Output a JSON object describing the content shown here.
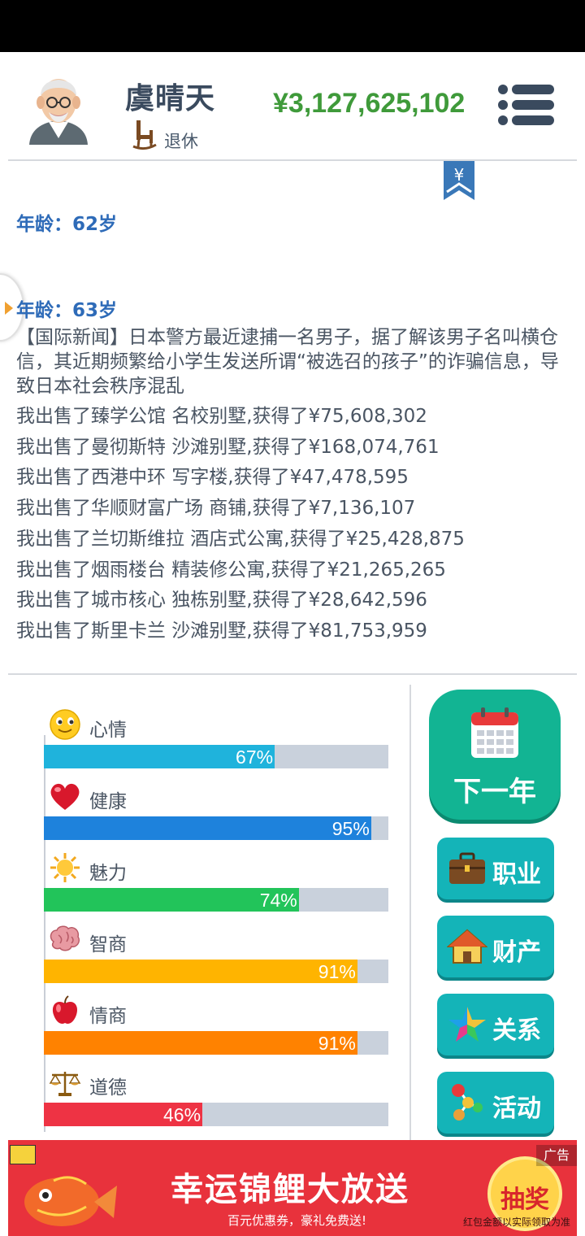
{
  "header": {
    "name": "虞晴天",
    "status": "退休",
    "money": "¥3,127,625,102"
  },
  "bookmark_symbol": "¥",
  "log": {
    "age1": "年龄：62岁",
    "age2": "年龄：63岁",
    "news": "【国际新闻】日本警方最近逮捕一名男子，据了解该男子名叫横仓信，其近期频繁给小学生发送所谓“被选召的孩子”的诈骗信息，导致日本社会秩序混乱",
    "events": [
      "我出售了臻学公馆 名校别墅,获得了¥75,608,302",
      "我出售了曼彻斯特 沙滩别墅,获得了¥168,074,761",
      "我出售了西港中环 写字楼,获得了¥47,478,595",
      "我出售了华顺财富广场 商铺,获得了¥7,136,107",
      "我出售了兰切斯维拉 酒店式公寓,获得了¥25,428,875",
      "我出售了烟雨楼台 精装修公寓,获得了¥21,265,265",
      "我出售了城市核心 独栋别墅,获得了¥28,642,596",
      "我出售了斯里卡兰 沙滩别墅,获得了¥81,753,959"
    ]
  },
  "stats": [
    {
      "label": "心情",
      "percent": 67,
      "value_text": "67%",
      "color": "#1fb3dc",
      "icon": "smiley-icon"
    },
    {
      "label": "健康",
      "percent": 95,
      "value_text": "95%",
      "color": "#1e82dc",
      "icon": "heart-icon"
    },
    {
      "label": "魅力",
      "percent": 74,
      "value_text": "74%",
      "color": "#22c45a",
      "icon": "sun-icon"
    },
    {
      "label": "智商",
      "percent": 91,
      "value_text": "91%",
      "color": "#ffb400",
      "icon": "brain-icon"
    },
    {
      "label": "情商",
      "percent": 91,
      "value_text": "91%",
      "color": "#ff8200",
      "icon": "apple-icon"
    },
    {
      "label": "道德",
      "percent": 46,
      "value_text": "46%",
      "color": "#ee3344",
      "icon": "scales-icon"
    }
  ],
  "buttons": {
    "next_year": "下一年",
    "career": "职业",
    "property": "财产",
    "relations": "关系",
    "activities": "活动"
  },
  "ad": {
    "tag": "广告",
    "title": "幸运锦鲤大放送",
    "subtitle": "百元优惠券，豪礼免费送!",
    "button": "抽奖",
    "disclaimer": "红包金额以实际领取为准"
  }
}
